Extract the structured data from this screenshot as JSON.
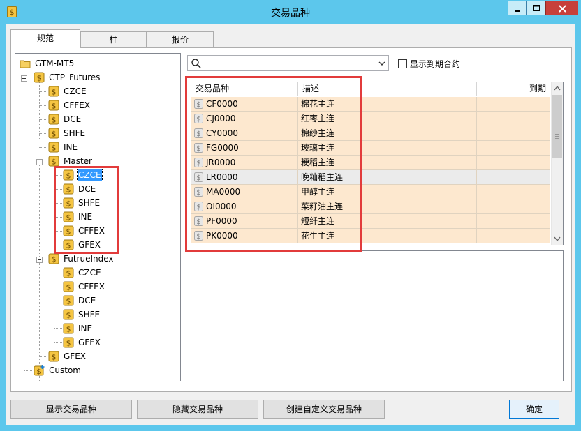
{
  "window": {
    "title": "交易品种"
  },
  "tabs": [
    {
      "label": "规范"
    },
    {
      "label": "柱"
    },
    {
      "label": "报价"
    }
  ],
  "tree": {
    "root": "GTM-MT5",
    "ctp_futures": {
      "label": "CTP_Futures",
      "children": [
        "CZCE",
        "CFFEX",
        "DCE",
        "SHFE",
        "INE"
      ]
    },
    "master": {
      "label": "Master",
      "children": [
        "CZCE",
        "DCE",
        "SHFE",
        "INE",
        "CFFEX",
        "GFEX"
      ]
    },
    "futrue_index": {
      "label": "FutrueIndex",
      "children": [
        "CZCE",
        "CFFEX",
        "DCE",
        "SHFE",
        "INE",
        "GFEX"
      ]
    },
    "gfex": "GFEX",
    "custom": "Custom"
  },
  "search": {
    "value": "",
    "placeholder": ""
  },
  "filter": {
    "show_expired_label": "显示到期合约",
    "show_expired_checked": false
  },
  "grid": {
    "columns": [
      "交易品种",
      "描述",
      "到期"
    ],
    "rows": [
      {
        "symbol": "CF0000",
        "desc": "棉花主连",
        "expiry": ""
      },
      {
        "symbol": "CJ0000",
        "desc": "红枣主连",
        "expiry": ""
      },
      {
        "symbol": "CY0000",
        "desc": "棉纱主连",
        "expiry": ""
      },
      {
        "symbol": "FG0000",
        "desc": "玻璃主连",
        "expiry": ""
      },
      {
        "symbol": "JR0000",
        "desc": "粳稻主连",
        "expiry": ""
      },
      {
        "symbol": "LR0000",
        "desc": "晚籼稻主连",
        "expiry": ""
      },
      {
        "symbol": "MA0000",
        "desc": "甲醇主连",
        "expiry": ""
      },
      {
        "symbol": "OI0000",
        "desc": "菜籽油主连",
        "expiry": ""
      },
      {
        "symbol": "PF0000",
        "desc": "短纤主连",
        "expiry": ""
      },
      {
        "symbol": "PK0000",
        "desc": "花生主连",
        "expiry": ""
      }
    ]
  },
  "buttons": {
    "show_symbol": "显示交易品种",
    "hide_symbol": "隐藏交易品种",
    "create_custom": "创建自定义交易品种",
    "ok": "确定"
  },
  "colors": {
    "titlebar": "#5cc7ec",
    "row_highlight": "#fde8cf",
    "selection": "#3399ff",
    "annotation_red": "#e23b3b"
  }
}
